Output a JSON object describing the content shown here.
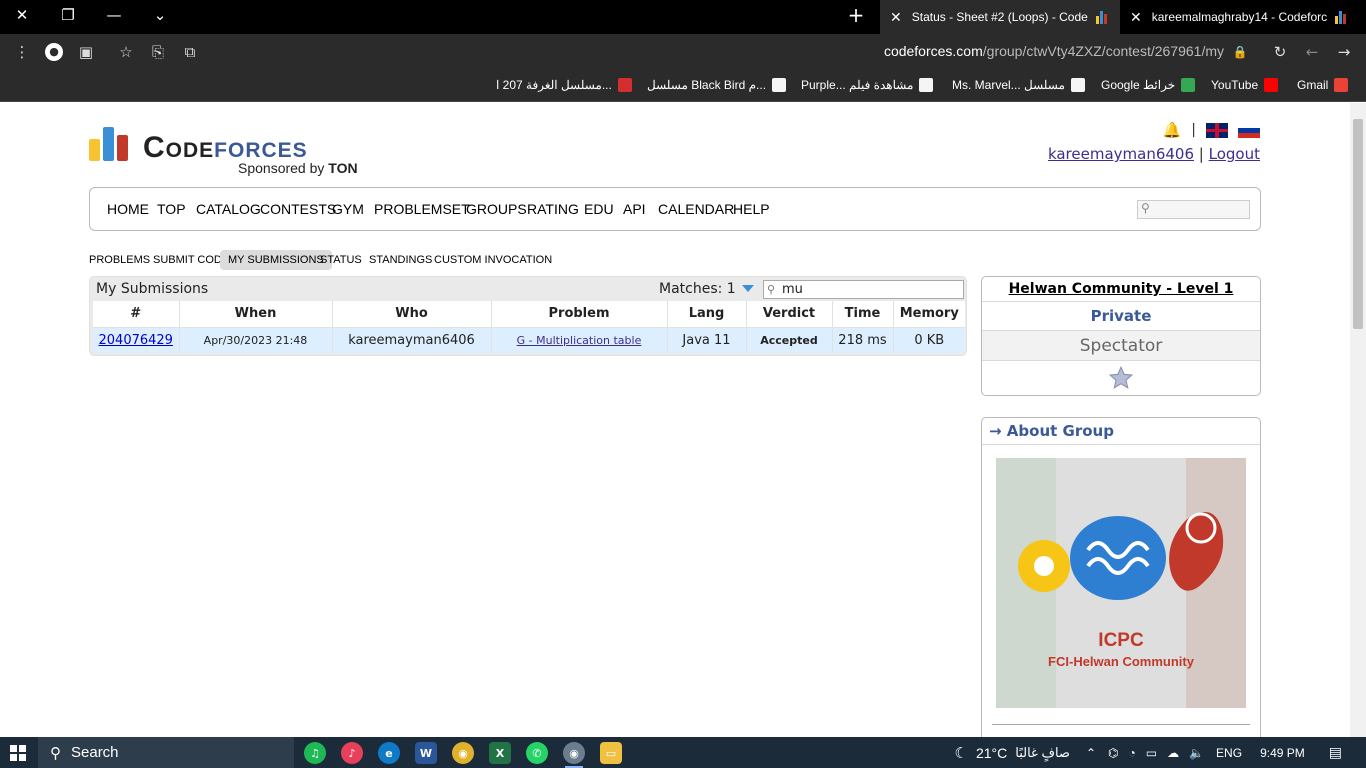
{
  "browser": {
    "tabs": [
      {
        "title": "Status - Sheet #2 (Loops) - Code",
        "active": true
      },
      {
        "title": "kareemalmaghraby14 - Codeforc",
        "active": false
      }
    ],
    "new_tab_label": "+",
    "url_host": "codeforces.com",
    "url_path": "/group/ctwVty4ZXZ/contest/267961/my",
    "bookmarks": [
      {
        "label": "Gmail",
        "color": "#ea4335"
      },
      {
        "label": "YouTube",
        "color": "#ff0000"
      },
      {
        "label": "Google خرائط",
        "color": "#34a853"
      },
      {
        "label": "Ms. Marvel... مسلسل",
        "color": "#f5f5f5"
      },
      {
        "label": "Purple... مشاهدة فيلم",
        "color": "#f5f5f5"
      },
      {
        "label": "مسلسل Black Bird م...",
        "color": "#f5f5f5"
      },
      {
        "label": "مسلسل الغرفة 207 ا...",
        "color": "#d32f2f"
      }
    ]
  },
  "header": {
    "logo_code": "Code",
    "logo_forces": "forces",
    "sponsor_prefix": "Sponsored by ",
    "sponsor_name": "TON",
    "separator": "|",
    "username": "kareemayman6406",
    "logout": "Logout"
  },
  "menu": [
    "HOME",
    "TOP",
    "CATALOG",
    "CONTESTS",
    "GYM",
    "PROBLEMSET",
    "GROUPS",
    "RATING",
    "EDU",
    "API",
    "CALENDAR",
    "HELP"
  ],
  "submenu": {
    "items": [
      "PROBLEMS",
      "SUBMIT CODE",
      "MY SUBMISSIONS",
      "STATUS",
      "STANDINGS",
      "CUSTOM INVOCATION"
    ],
    "selected": "MY SUBMISSIONS"
  },
  "submissions": {
    "title": "My Submissions",
    "matches_label": "Matches: 1",
    "filter_value": "mu",
    "columns": [
      "#",
      "When",
      "Who",
      "Problem",
      "Lang",
      "Verdict",
      "Time",
      "Memory"
    ],
    "rows": [
      {
        "id": "204076429",
        "when": "Apr/30/2023 21:48",
        "who": "kareemayman6406",
        "problem": "G - Multiplication table",
        "lang": "Java 11",
        "verdict": "Accepted",
        "time": "218 ms",
        "memory": "0 KB"
      }
    ]
  },
  "sidebar": {
    "contest_name": "Helwan Community - Level 1",
    "visibility": "Private",
    "role": "Spectator",
    "about_title": "→ About Group",
    "group_image_title": "ICPC",
    "group_image_subtitle": "FCI-Helwan Community"
  },
  "taskbar": {
    "search_label": "Search",
    "weather_temp": "21°C",
    "weather_desc": "صافٍ غالبًا",
    "language": "ENG",
    "time": "9:49 PM"
  },
  "colors": {
    "accent_blue": "#3b5998",
    "accepted_green": "#00aa00",
    "row_highlight": "#ddeeff"
  }
}
